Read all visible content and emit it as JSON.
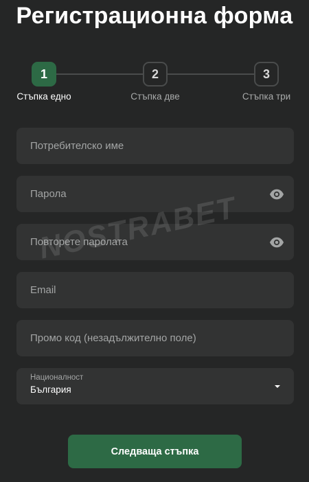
{
  "title": "Регистрационна форма",
  "stepper": {
    "steps": [
      {
        "number": "1",
        "label": "Стъпка едно",
        "active": true
      },
      {
        "number": "2",
        "label": "Стъпка две",
        "active": false
      },
      {
        "number": "3",
        "label": "Стъпка три",
        "active": false
      }
    ]
  },
  "form": {
    "username": {
      "placeholder": "Потребителско име",
      "value": ""
    },
    "password": {
      "placeholder": "Парола",
      "value": "",
      "icon": "eye-icon"
    },
    "password_repeat": {
      "placeholder": "Повторете паролата",
      "value": "",
      "icon": "eye-icon"
    },
    "email": {
      "placeholder": "Email",
      "value": ""
    },
    "promo": {
      "placeholder": "Промо код (незадължително поле)",
      "value": ""
    },
    "nationality": {
      "label": "Националност",
      "selected": "България",
      "icon": "caret-down-icon"
    }
  },
  "next_button": {
    "label": "Следваща стъпка"
  },
  "watermark": "NOSTRABET",
  "colors": {
    "background": "#252626",
    "field": "#323333",
    "accent": "#2d6a45",
    "placeholder": "#a3a5a5"
  }
}
